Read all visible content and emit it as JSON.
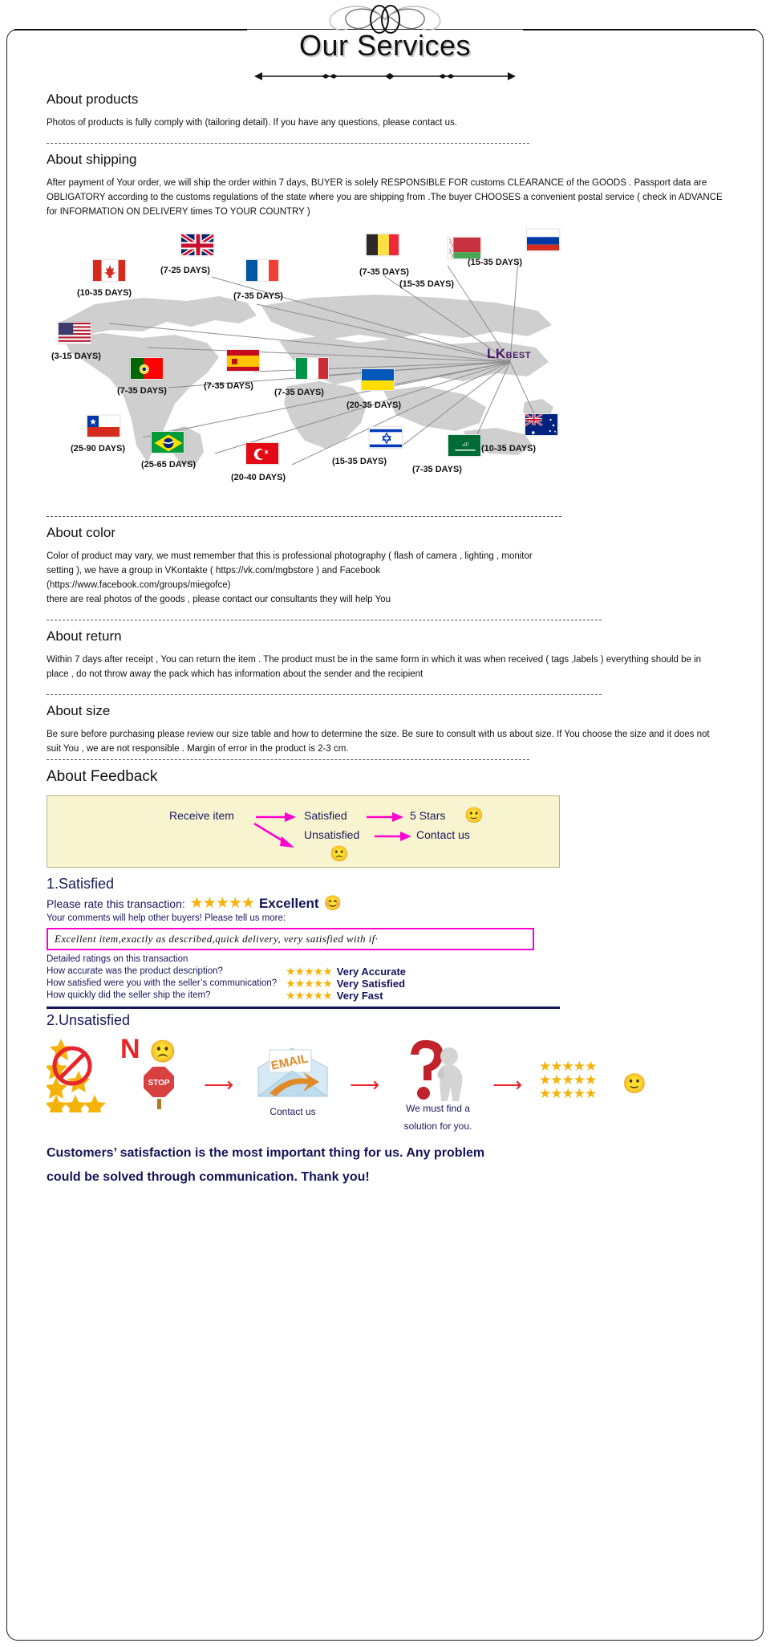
{
  "header": {
    "title": "Our Services"
  },
  "sections": {
    "products": {
      "heading": "About products",
      "body": "Photos of products is fully comply with (tailoring detail). If you have any questions, please contact us."
    },
    "shipping": {
      "heading": "About shipping",
      "body": "After payment of Your order, we will ship the order within 7 days, BUYER is solely RESPONSIBLE FOR customs CLEARANCE of the GOODS . Passport data are OBLIGATORY according to the customs regulations of the state where you are shipping from .The buyer CHOOSES a convenient postal service ( check in ADVANCE for INFORMATION ON DELIVERY times TO YOUR COUNTRY )"
    },
    "color": {
      "heading": "About color",
      "body_line1": "Color of product may vary, we must remember that this is professional photography ( flash of camera , lighting , monitor",
      "body_line2": "setting ), we have a group in VKontakte ( https://vk.com/mgbstore ) and Facebook",
      "body_line3": "(https://www.facebook.com/groups/miegofce)",
      "body_line4": " there are real photos of the goods , please contact our consultants they will help You"
    },
    "return": {
      "heading": "About return",
      "body": "Within 7 days after receipt , You can return the item . The product must be in the same form in which it was when received ( tags ,labels ) everything should be in place , do not throw away the pack which has information about the sender and the recipient"
    },
    "size": {
      "heading": "About size",
      "body": "Be sure before purchasing  please review our size table and how to determine the size. Be sure to consult with us about size. If You choose the size and it does not suit You , we are not responsible . Margin of error in the product is 2-3 cm."
    },
    "feedback": {
      "heading": "About Feedback"
    }
  },
  "map": {
    "brand": "LK",
    "brand_suffix": "BEST",
    "destinations": [
      {
        "country": "canada",
        "flag": "canada-flag",
        "days": "(10-35 DAYS)"
      },
      {
        "country": "united-kingdom",
        "flag": "uk-flag",
        "days": "(7-25 DAYS)"
      },
      {
        "country": "france",
        "flag": "france-flag",
        "days": "(7-35 DAYS)"
      },
      {
        "country": "belgium",
        "flag": "belgium-flag",
        "days": "(7-35 DAYS)"
      },
      {
        "country": "belarus",
        "flag": "belarus-flag",
        "days": "(15-35 DAYS)"
      },
      {
        "country": "russia",
        "flag": "russia-flag",
        "days": "(15-35 DAYS)"
      },
      {
        "country": "united-states",
        "flag": "usa-flag",
        "days": "(3-15 DAYS)"
      },
      {
        "country": "portugal",
        "flag": "portugal-flag",
        "days": "(7-35 DAYS)"
      },
      {
        "country": "spain",
        "flag": "spain-flag",
        "days": "(7-35 DAYS)"
      },
      {
        "country": "italy",
        "flag": "italy-flag",
        "days": "(7-35 DAYS)"
      },
      {
        "country": "ukraine",
        "flag": "ukraine-flag",
        "days": "(20-35 DAYS)"
      },
      {
        "country": "chile",
        "flag": "chile-flag",
        "days": "(25-90 DAYS)"
      },
      {
        "country": "brazil",
        "flag": "brazil-flag",
        "days": "(25-65 DAYS)"
      },
      {
        "country": "turkey",
        "flag": "turkey-flag",
        "days": "(20-40 DAYS)"
      },
      {
        "country": "israel",
        "flag": "israel-flag",
        "days": "(15-35 DAYS)"
      },
      {
        "country": "saudi-arabia",
        "flag": "saudi-arabia-flag",
        "days": "(7-35 DAYS)"
      },
      {
        "country": "australia",
        "flag": "australia-flag",
        "days": "(10-35 DAYS)"
      }
    ]
  },
  "flow": {
    "receive_item": "Receive item",
    "satisfied": "Satisfied",
    "five_stars": "5 Stars",
    "unsatisfied": "Unsatisfied",
    "contact_us": "Contact us",
    "happy_emoji": "🙂",
    "sad_emoji": "🙁"
  },
  "satisfied": {
    "heading": "1.Satisfied",
    "rate_prompt": "Please rate this transaction:",
    "stars": "★★★★★",
    "rating_word": "Excellent",
    "smiley": "😊",
    "comments_prompt": "Your comments will help other buyers! Please tell us more:",
    "comment_value": "Excellent item,exactly as described,quick delivery,  very satisfied with if·",
    "detailed_title": "Detailed ratings on this transaction",
    "rows": [
      {
        "question": "How accurate was the product description?",
        "stars": "★★★★★",
        "answer": "Very Accurate"
      },
      {
        "question": "How satisfied were you with the seller’s communication?",
        "stars": "★★★★★",
        "answer": "Very Satisfied"
      },
      {
        "question": "How quickly did the seller ship the item?",
        "stars": "★★★★★",
        "answer": "Very Fast"
      }
    ]
  },
  "unsatisfied": {
    "heading": "2.Unsatisfied",
    "no_label": "N",
    "stop_label": "STOP",
    "email_label": "EMAIL",
    "contact_caption": "Contact us",
    "solution_caption_line1": "We must find a",
    "solution_caption_line2": "solution for you.",
    "final_stars": "★★★★★",
    "final_smiley": "🙂"
  },
  "closing": {
    "line1": "Customers’ satisfaction is the most important thing for us. Any problem",
    "line2": "could be solved through communication. Thank you!"
  },
  "colors": {
    "navy": "#17175c",
    "gold": "#f5b30a",
    "magenta": "#ff00d0",
    "red_arrow": "#e8252a",
    "feedback_bg": "#f8f4cf",
    "map_land": "#cfcfcf",
    "brand_purple": "#4b1768"
  }
}
